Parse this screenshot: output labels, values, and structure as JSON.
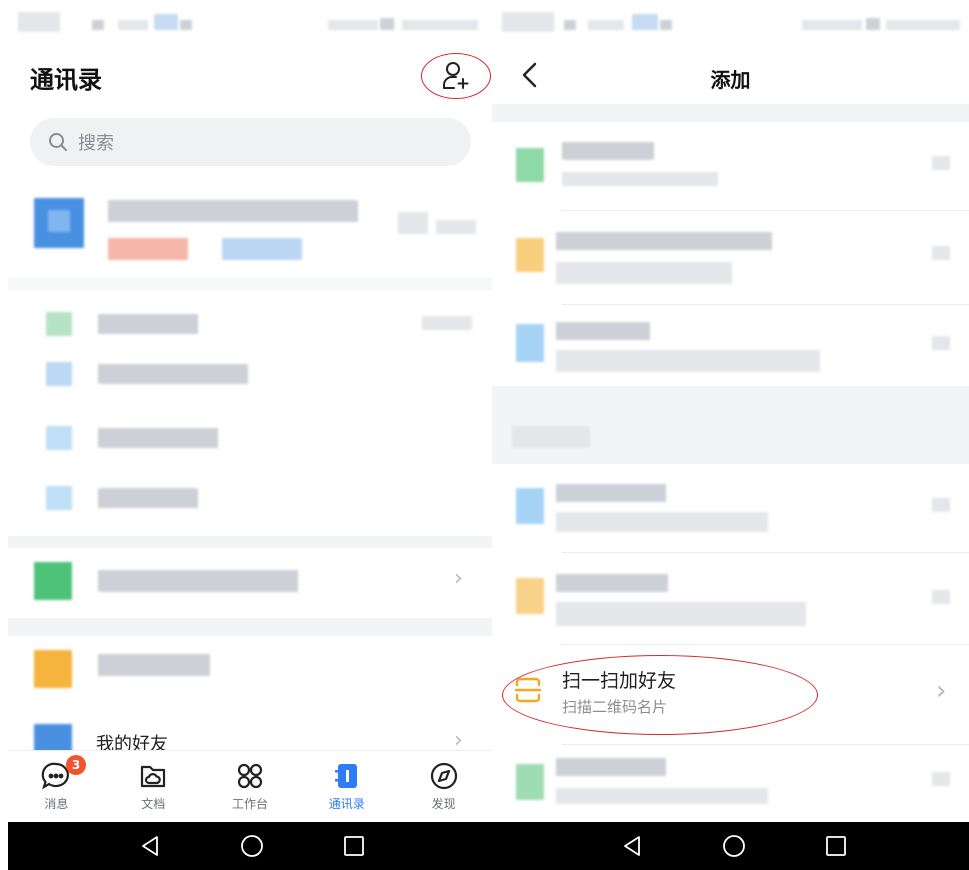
{
  "left": {
    "title": "通讯录",
    "search_placeholder": "搜索",
    "my_friends_label": "我的好友",
    "add_contact_icon": "person-add-icon"
  },
  "tabs": [
    {
      "label": "消息",
      "icon": "chat-bubble-icon",
      "badge": "3",
      "active": false
    },
    {
      "label": "文档",
      "icon": "folder-cloud-icon",
      "active": false
    },
    {
      "label": "工作台",
      "icon": "grid-apps-icon",
      "active": false
    },
    {
      "label": "通讯录",
      "icon": "contacts-book-icon",
      "active": true
    },
    {
      "label": "发现",
      "icon": "compass-icon",
      "active": false
    }
  ],
  "right": {
    "title": "添加",
    "scan_title": "扫一扫加好友",
    "scan_subtitle": "扫描二维码名片"
  },
  "colors": {
    "accent": "#2d7df6",
    "annotation": "#d8262b",
    "badge": "#f0552d",
    "scan_icon": "#f5a623"
  }
}
